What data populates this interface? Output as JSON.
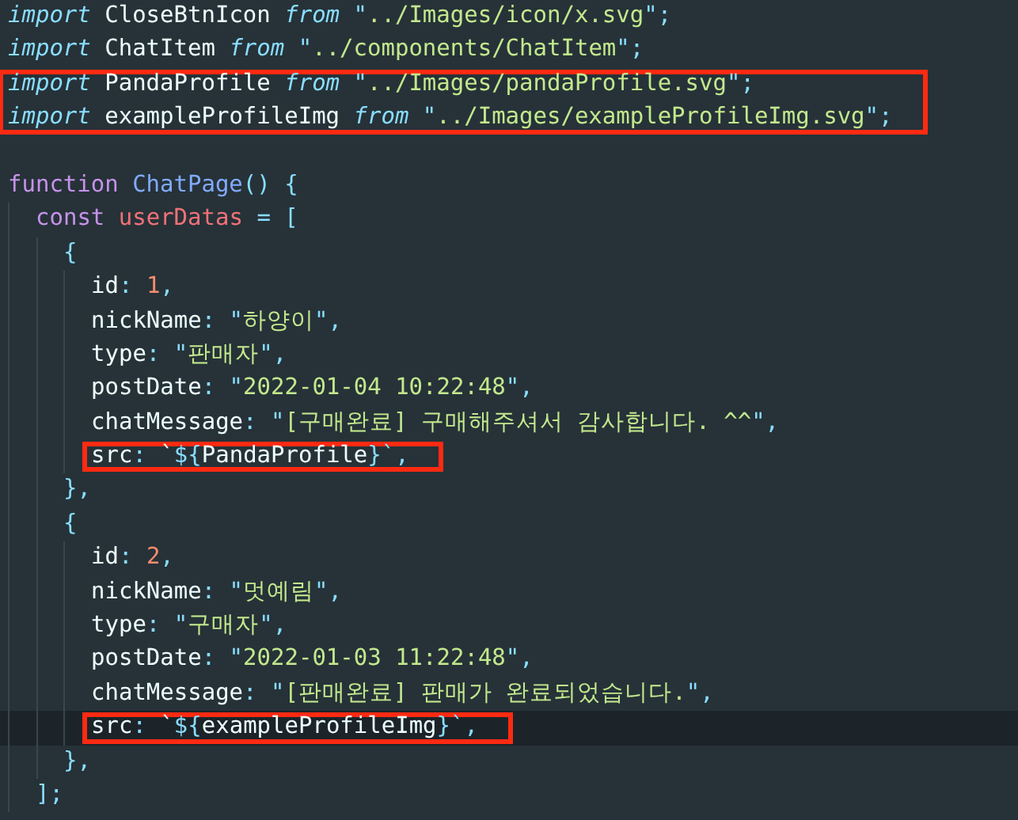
{
  "editor": {
    "blocks": [
      {
        "boxed": false,
        "current": false,
        "lines": [
          [
            {
              "kind": "kw",
              "text": "import"
            },
            {
              "kind": "plain",
              "text": " CloseBtnIcon "
            },
            {
              "kind": "kw",
              "text": "from"
            },
            {
              "kind": "punct",
              "text": " \""
            },
            {
              "kind": "str",
              "text": "../Images/icon/x.svg"
            },
            {
              "kind": "punct",
              "text": "\";"
            }
          ],
          [
            {
              "kind": "kw",
              "text": "import"
            },
            {
              "kind": "plain",
              "text": " ChatItem "
            },
            {
              "kind": "kw",
              "text": "from"
            },
            {
              "kind": "punct",
              "text": " \""
            },
            {
              "kind": "str",
              "text": "../components/ChatItem"
            },
            {
              "kind": "punct",
              "text": "\";"
            }
          ]
        ]
      },
      {
        "boxed": true,
        "current": false,
        "lines": [
          [
            {
              "kind": "kw",
              "text": "import"
            },
            {
              "kind": "plain",
              "text": " PandaProfile "
            },
            {
              "kind": "kw",
              "text": "from"
            },
            {
              "kind": "punct",
              "text": " \""
            },
            {
              "kind": "str",
              "text": "../Images/pandaProfile.svg"
            },
            {
              "kind": "punct",
              "text": "\";"
            }
          ],
          [
            {
              "kind": "kw",
              "text": "import"
            },
            {
              "kind": "plain",
              "text": " exampleProfileImg "
            },
            {
              "kind": "kw",
              "text": "from"
            },
            {
              "kind": "punct",
              "text": " \""
            },
            {
              "kind": "str",
              "text": "../Images/exampleProfileImg.svg"
            },
            {
              "kind": "punct",
              "text": "\";"
            }
          ]
        ]
      },
      {
        "boxed": false,
        "current": false,
        "blank_line_before": true,
        "lines": [
          [
            {
              "kind": "storage",
              "text": "function"
            },
            {
              "kind": "fn",
              "text": " ChatPage"
            },
            {
              "kind": "punct",
              "text": "() {"
            }
          ]
        ],
        "children": [
          {
            "boxed": false,
            "current": false,
            "lines": [
              [
                {
                  "kind": "storage",
                  "text": "const"
                },
                {
                  "kind": "var",
                  "text": " userDatas"
                },
                {
                  "kind": "punct",
                  "text": " = ["
                }
              ]
            ],
            "children": [
              {
                "boxed": false,
                "current": false,
                "lines": [
                  [
                    {
                      "kind": "punct",
                      "text": "{"
                    }
                  ]
                ],
                "children": [
                  {
                    "boxed": false,
                    "current": false,
                    "lines": [
                      [
                        {
                          "kind": "plain",
                          "text": "id"
                        },
                        {
                          "kind": "punct",
                          "text": ": "
                        },
                        {
                          "kind": "num",
                          "text": "1"
                        },
                        {
                          "kind": "punct",
                          "text": ","
                        }
                      ],
                      [
                        {
                          "kind": "plain",
                          "text": "nickName"
                        },
                        {
                          "kind": "punct",
                          "text": ": \""
                        },
                        {
                          "kind": "str",
                          "text": "하양이"
                        },
                        {
                          "kind": "punct",
                          "text": "\","
                        }
                      ],
                      [
                        {
                          "kind": "plain",
                          "text": "type"
                        },
                        {
                          "kind": "punct",
                          "text": ": \""
                        },
                        {
                          "kind": "str",
                          "text": "판매자"
                        },
                        {
                          "kind": "punct",
                          "text": "\","
                        }
                      ],
                      [
                        {
                          "kind": "plain",
                          "text": "postDate"
                        },
                        {
                          "kind": "punct",
                          "text": ": \""
                        },
                        {
                          "kind": "str",
                          "text": "2022-01-04 10:22:48"
                        },
                        {
                          "kind": "punct",
                          "text": "\","
                        }
                      ],
                      [
                        {
                          "kind": "plain",
                          "text": "chatMessage"
                        },
                        {
                          "kind": "punct",
                          "text": ": \""
                        },
                        {
                          "kind": "str",
                          "text": "[구매완료] 구매해주셔서 감사합니다. ^^"
                        },
                        {
                          "kind": "punct",
                          "text": "\","
                        }
                      ]
                    ]
                  },
                  {
                    "boxed": true,
                    "current": false,
                    "lines": [
                      [
                        {
                          "kind": "plain",
                          "text": "src"
                        },
                        {
                          "kind": "punct",
                          "text": ": "
                        },
                        {
                          "kind": "plain",
                          "text": "`"
                        },
                        {
                          "kind": "punct",
                          "text": "${"
                        },
                        {
                          "kind": "plain",
                          "text": "PandaProfile"
                        },
                        {
                          "kind": "punct",
                          "text": "}`,"
                        }
                      ]
                    ]
                  }
                ],
                "closing": [
                  [
                    {
                      "kind": "punct",
                      "text": "},"
                    }
                  ]
                ]
              },
              {
                "boxed": false,
                "current": false,
                "lines": [
                  [
                    {
                      "kind": "punct",
                      "text": "{"
                    }
                  ]
                ],
                "children": [
                  {
                    "boxed": false,
                    "current": false,
                    "lines": [
                      [
                        {
                          "kind": "plain",
                          "text": "id"
                        },
                        {
                          "kind": "punct",
                          "text": ": "
                        },
                        {
                          "kind": "num",
                          "text": "2"
                        },
                        {
                          "kind": "punct",
                          "text": ","
                        }
                      ],
                      [
                        {
                          "kind": "plain",
                          "text": "nickName"
                        },
                        {
                          "kind": "punct",
                          "text": ": \""
                        },
                        {
                          "kind": "str",
                          "text": "멋예림"
                        },
                        {
                          "kind": "punct",
                          "text": "\","
                        }
                      ],
                      [
                        {
                          "kind": "plain",
                          "text": "type"
                        },
                        {
                          "kind": "punct",
                          "text": ": \""
                        },
                        {
                          "kind": "str",
                          "text": "구매자"
                        },
                        {
                          "kind": "punct",
                          "text": "\","
                        }
                      ],
                      [
                        {
                          "kind": "plain",
                          "text": "postDate"
                        },
                        {
                          "kind": "punct",
                          "text": ": \""
                        },
                        {
                          "kind": "str",
                          "text": "2022-01-03 11:22:48"
                        },
                        {
                          "kind": "punct",
                          "text": "\","
                        }
                      ],
                      [
                        {
                          "kind": "plain",
                          "text": "chatMessage"
                        },
                        {
                          "kind": "punct",
                          "text": ": \""
                        },
                        {
                          "kind": "str",
                          "text": "[판매완료] 판매가 완료되었습니다."
                        },
                        {
                          "kind": "punct",
                          "text": "\","
                        }
                      ]
                    ]
                  },
                  {
                    "boxed": true,
                    "current": true,
                    "lines": [
                      [
                        {
                          "kind": "plain",
                          "text": "src"
                        },
                        {
                          "kind": "punct",
                          "text": ": "
                        },
                        {
                          "kind": "plain",
                          "text": "`"
                        },
                        {
                          "kind": "punct",
                          "text": "${"
                        },
                        {
                          "kind": "plain",
                          "text": "exampleProfileImg"
                        },
                        {
                          "kind": "punct",
                          "text": "}`,"
                        }
                      ]
                    ]
                  }
                ],
                "closing": [
                  [
                    {
                      "kind": "punct",
                      "text": "},"
                    }
                  ]
                ]
              }
            ],
            "closing": [
              [
                {
                  "kind": "punct",
                  "text": "];"
                }
              ]
            ]
          }
        ]
      }
    ]
  }
}
